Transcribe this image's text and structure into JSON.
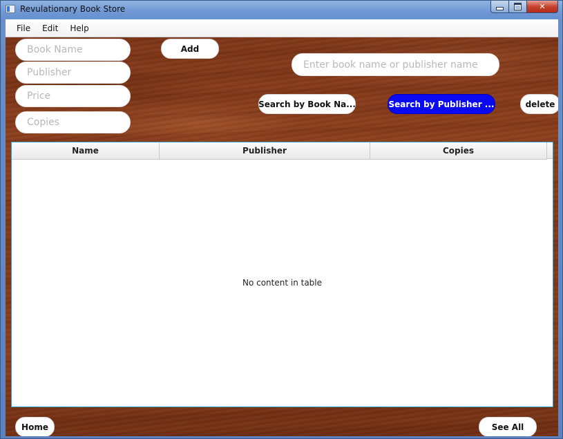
{
  "window": {
    "title": "Revulationary Book Store"
  },
  "menu": {
    "items": [
      "File",
      "Edit",
      "Help"
    ]
  },
  "form": {
    "book_name_placeholder": "Book Name",
    "publisher_placeholder": "Publisher",
    "price_placeholder": "Price",
    "copies_placeholder": "Copies",
    "add_label": "Add"
  },
  "search": {
    "placeholder": "Enter book name or publisher name",
    "by_book_label": "Search by Book Na...",
    "by_publisher_label": "Search by Publisher ...",
    "delete_label": "delete"
  },
  "table": {
    "columns": [
      "Name",
      "Publisher",
      "Copies"
    ],
    "empty_message": "No content in table"
  },
  "footer": {
    "home_label": "Home",
    "see_all_label": "See All"
  },
  "colors": {
    "primary_button": "#0a0af2",
    "table_border": "#2ca6cf"
  }
}
